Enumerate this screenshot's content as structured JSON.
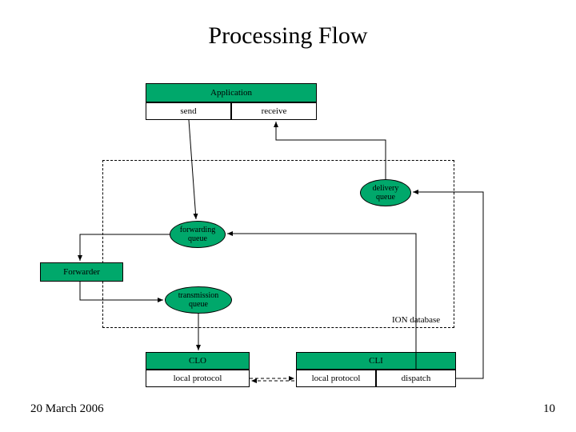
{
  "title": "Processing Flow",
  "application": {
    "label": "Application",
    "send": "send",
    "receive": "receive"
  },
  "queues": {
    "delivery": "delivery\nqueue",
    "forwarding": "forwarding\nqueue",
    "transmission": "transmission\nqueue"
  },
  "forwarder": "Forwarder",
  "ion_label": "ION database",
  "clo": {
    "label": "CLO",
    "local_protocol": "local protocol"
  },
  "cli": {
    "label": "CLI",
    "local_protocol": "local protocol",
    "dispatch": "dispatch"
  },
  "footer": {
    "date": "20 March 2006",
    "page": "10"
  }
}
